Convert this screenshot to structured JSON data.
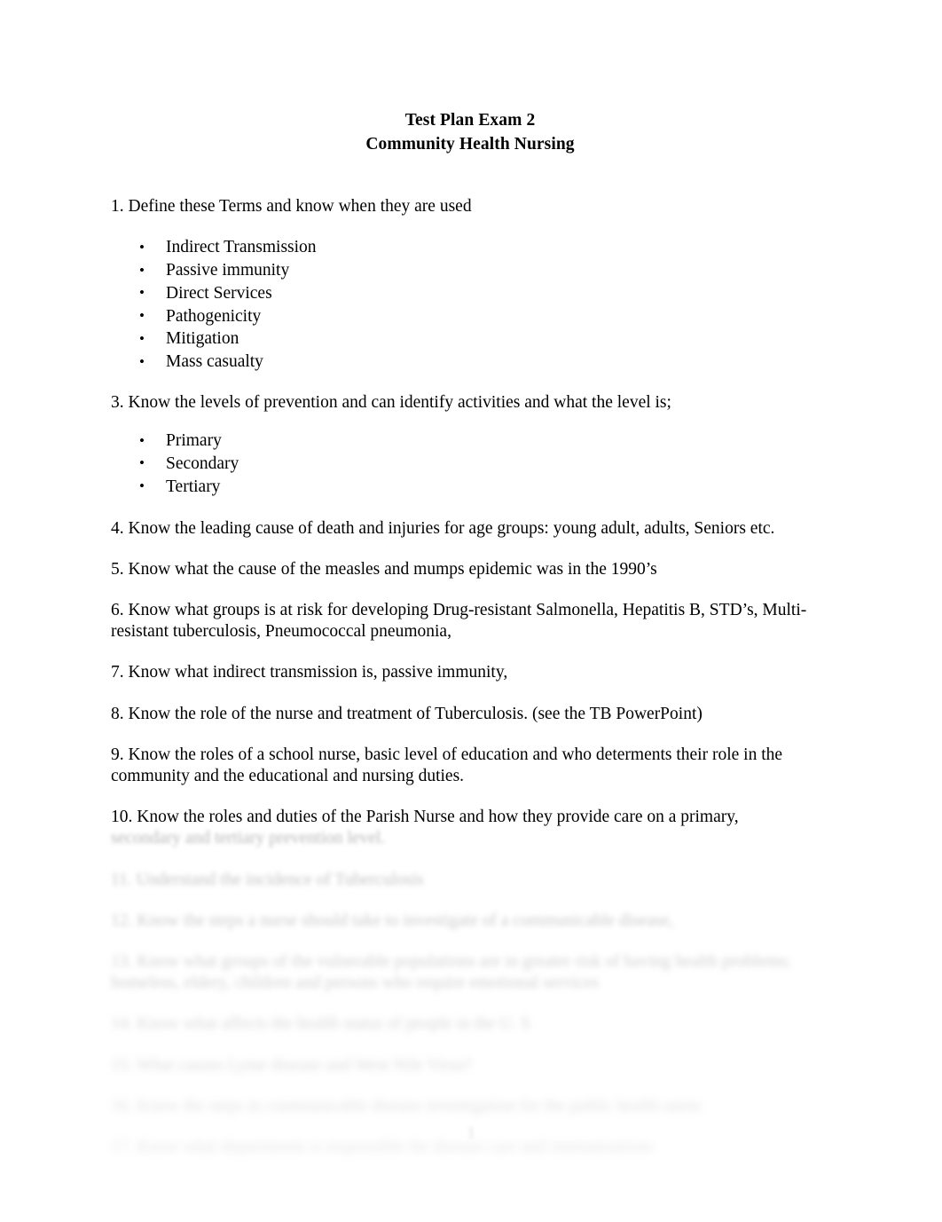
{
  "document": {
    "title_line_1": "Test Plan Exam 2",
    "title_line_2": "Community Health Nursing",
    "page_number": "1"
  },
  "items": {
    "q1": "1. Define these Terms and know when they are used",
    "q1_bullets": [
      "Indirect Transmission",
      "Passive immunity",
      "Direct Services",
      "Pathogenicity",
      "Mitigation",
      "Mass casualty"
    ],
    "q3": "3. Know the levels of prevention and can identify activities and what the level is;",
    "q3_bullets": [
      "Primary",
      "Secondary",
      "Tertiary"
    ],
    "q4": "4. Know the leading cause of death and injuries for age groups: young adult, adults, Seniors etc.",
    "q5": "5. Know what the cause of the measles and mumps epidemic was in the 1990’s",
    "q6": "6. Know what groups is at risk for developing Drug-resistant Salmonella, Hepatitis B, STD’s, Multi- resistant tuberculosis, Pneumococcal pneumonia,",
    "q7": "7. Know what indirect transmission is, passive immunity,",
    "q8": "8. Know the role of the nurse and treatment of Tuberculosis. (see the TB PowerPoint)",
    "q9": "9. Know the roles of a school nurse, basic level of education and who determents their role in the community and the educational and nursing duties.",
    "q10_line1": "10. Know the roles and duties of the Parish Nurse and how they provide care on a primary,",
    "q10_line2": "secondary and tertiary prevention level.",
    "q11": "11. Understand the incidence of Tuberculosis",
    "q12": "12. Know the steps a nurse should take to investigate of a communicable disease,",
    "q13": "13. Know what groups of the vulnerable populations are in greater risk of having health problems; homeless, eldery, children and persons who require emotional services",
    "q14": "14. Know what affects the health status of people in the U. S",
    "q15": "15. What causes Lyme disease and West Nile Virus?",
    "q16": "16. Know the steps in communicable disease investigation for the public health nurse",
    "q17": "17. Know what departments is responsible for disease care and immunizations"
  },
  "bullet_glyph": "•"
}
